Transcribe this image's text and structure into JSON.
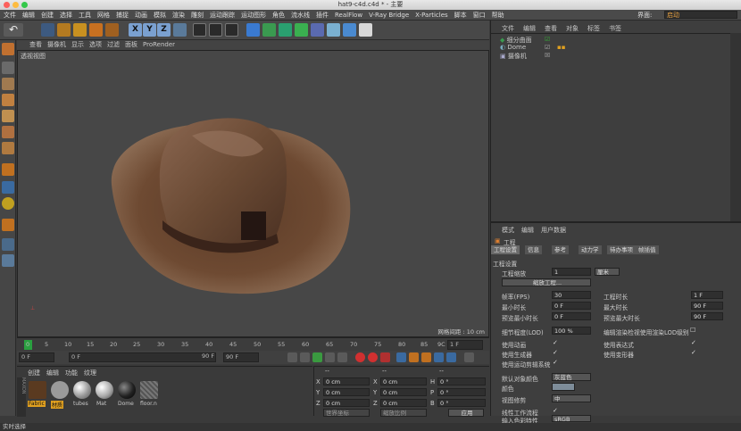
{
  "window": {
    "title": "hat9-c4d.c4d * - 主要"
  },
  "menubar": {
    "items": [
      "文件",
      "编辑",
      "创建",
      "选择",
      "工具",
      "网格",
      "捕捉",
      "动画",
      "模拟",
      "渲染",
      "雕刻",
      "运动跟踪",
      "运动图形",
      "角色",
      "流水线",
      "插件",
      "RealFlow",
      "V-Ray Bridge",
      "X-Particles",
      "脚本",
      "窗口",
      "帮助"
    ],
    "layout_label": "界面:",
    "layout_value": "启动"
  },
  "viewport": {
    "menu": [
      "查看",
      "摄像机",
      "显示",
      "选项",
      "过滤",
      "面板",
      "ProRender"
    ],
    "label": "透视视图",
    "grid_info": "网格间距 : 10 cm"
  },
  "timeline": {
    "ticks": [
      "0",
      "5",
      "10",
      "15",
      "20",
      "25",
      "30",
      "35",
      "40",
      "45",
      "50",
      "55",
      "60",
      "65",
      "70",
      "75",
      "80",
      "85",
      "9C"
    ],
    "current_frame": "1 F"
  },
  "playbar": {
    "start": "0 F",
    "start2": "0 F",
    "end": "90 F",
    "end2": "90 F"
  },
  "material_manager": {
    "menu": [
      "创建",
      "编辑",
      "功能",
      "纹理"
    ],
    "materials": [
      "Fabric",
      "材质",
      "tubes",
      "Mat",
      "Dome",
      "floor.n"
    ]
  },
  "coordinates": {
    "headers": [
      "--",
      "--",
      "--"
    ],
    "rows": [
      {
        "a": "X",
        "av": "0 cm",
        "b": "X",
        "bv": "0 cm",
        "c": "H",
        "cv": "0 °"
      },
      {
        "a": "Y",
        "av": "0 cm",
        "b": "Y",
        "bv": "0 cm",
        "c": "P",
        "cv": "0 °"
      },
      {
        "a": "Z",
        "av": "0 cm",
        "b": "Z",
        "bv": "0 cm",
        "c": "B",
        "cv": "0 °"
      }
    ],
    "mode1": "世界坐标",
    "mode2": "缩放比例",
    "apply": "应用"
  },
  "object_manager": {
    "menu": [
      "文件",
      "编辑",
      "查看",
      "对象",
      "标签",
      "书签"
    ],
    "objects": [
      "细分曲面",
      "Dome",
      "摄像机"
    ]
  },
  "attributes": {
    "menu": [
      "模式",
      "编辑",
      "用户数据"
    ],
    "title": "工程",
    "tabs": [
      "工程设置",
      "信息",
      "参考",
      "动力学",
      "待办事项",
      "帧插值"
    ],
    "section": "工程设置",
    "scale_label": "工程缩放",
    "scale_value": "1",
    "scale_unit": "厘米",
    "scale_button": "缩放工程...",
    "fps_label": "帧率(FPS)",
    "fps_value": "30",
    "len_label": "工程时长",
    "len_value": "1 F",
    "min_label": "最小时长",
    "min_value": "0 F",
    "max_label": "最大时长",
    "max_value": "90 F",
    "pmin_label": "预览最小时长",
    "pmin_value": "0 F",
    "pmax_label": "预览最大时长",
    "pmax_value": "90 F",
    "lod_label": "细节程度(LOD)",
    "lod_value": "100 %",
    "lod_text": "编辑渲染检视使用渲染LOD级别",
    "anim_label": "使用动画",
    "expr_label": "使用表达式",
    "gen_label": "使用生成器",
    "deform_label": "使用变形器",
    "motion_label": "使用运动剪辑系统",
    "defcolor_label": "默认对象颜色",
    "defcolor_value": "灰蓝色",
    "color_label": "颜色",
    "clip_label": "视图修剪",
    "clip_value": "中",
    "linear_label": "线性工作流程",
    "input_label": "输入色彩特性",
    "input_value": "sRGB"
  },
  "status": {
    "text": "实时选择"
  }
}
